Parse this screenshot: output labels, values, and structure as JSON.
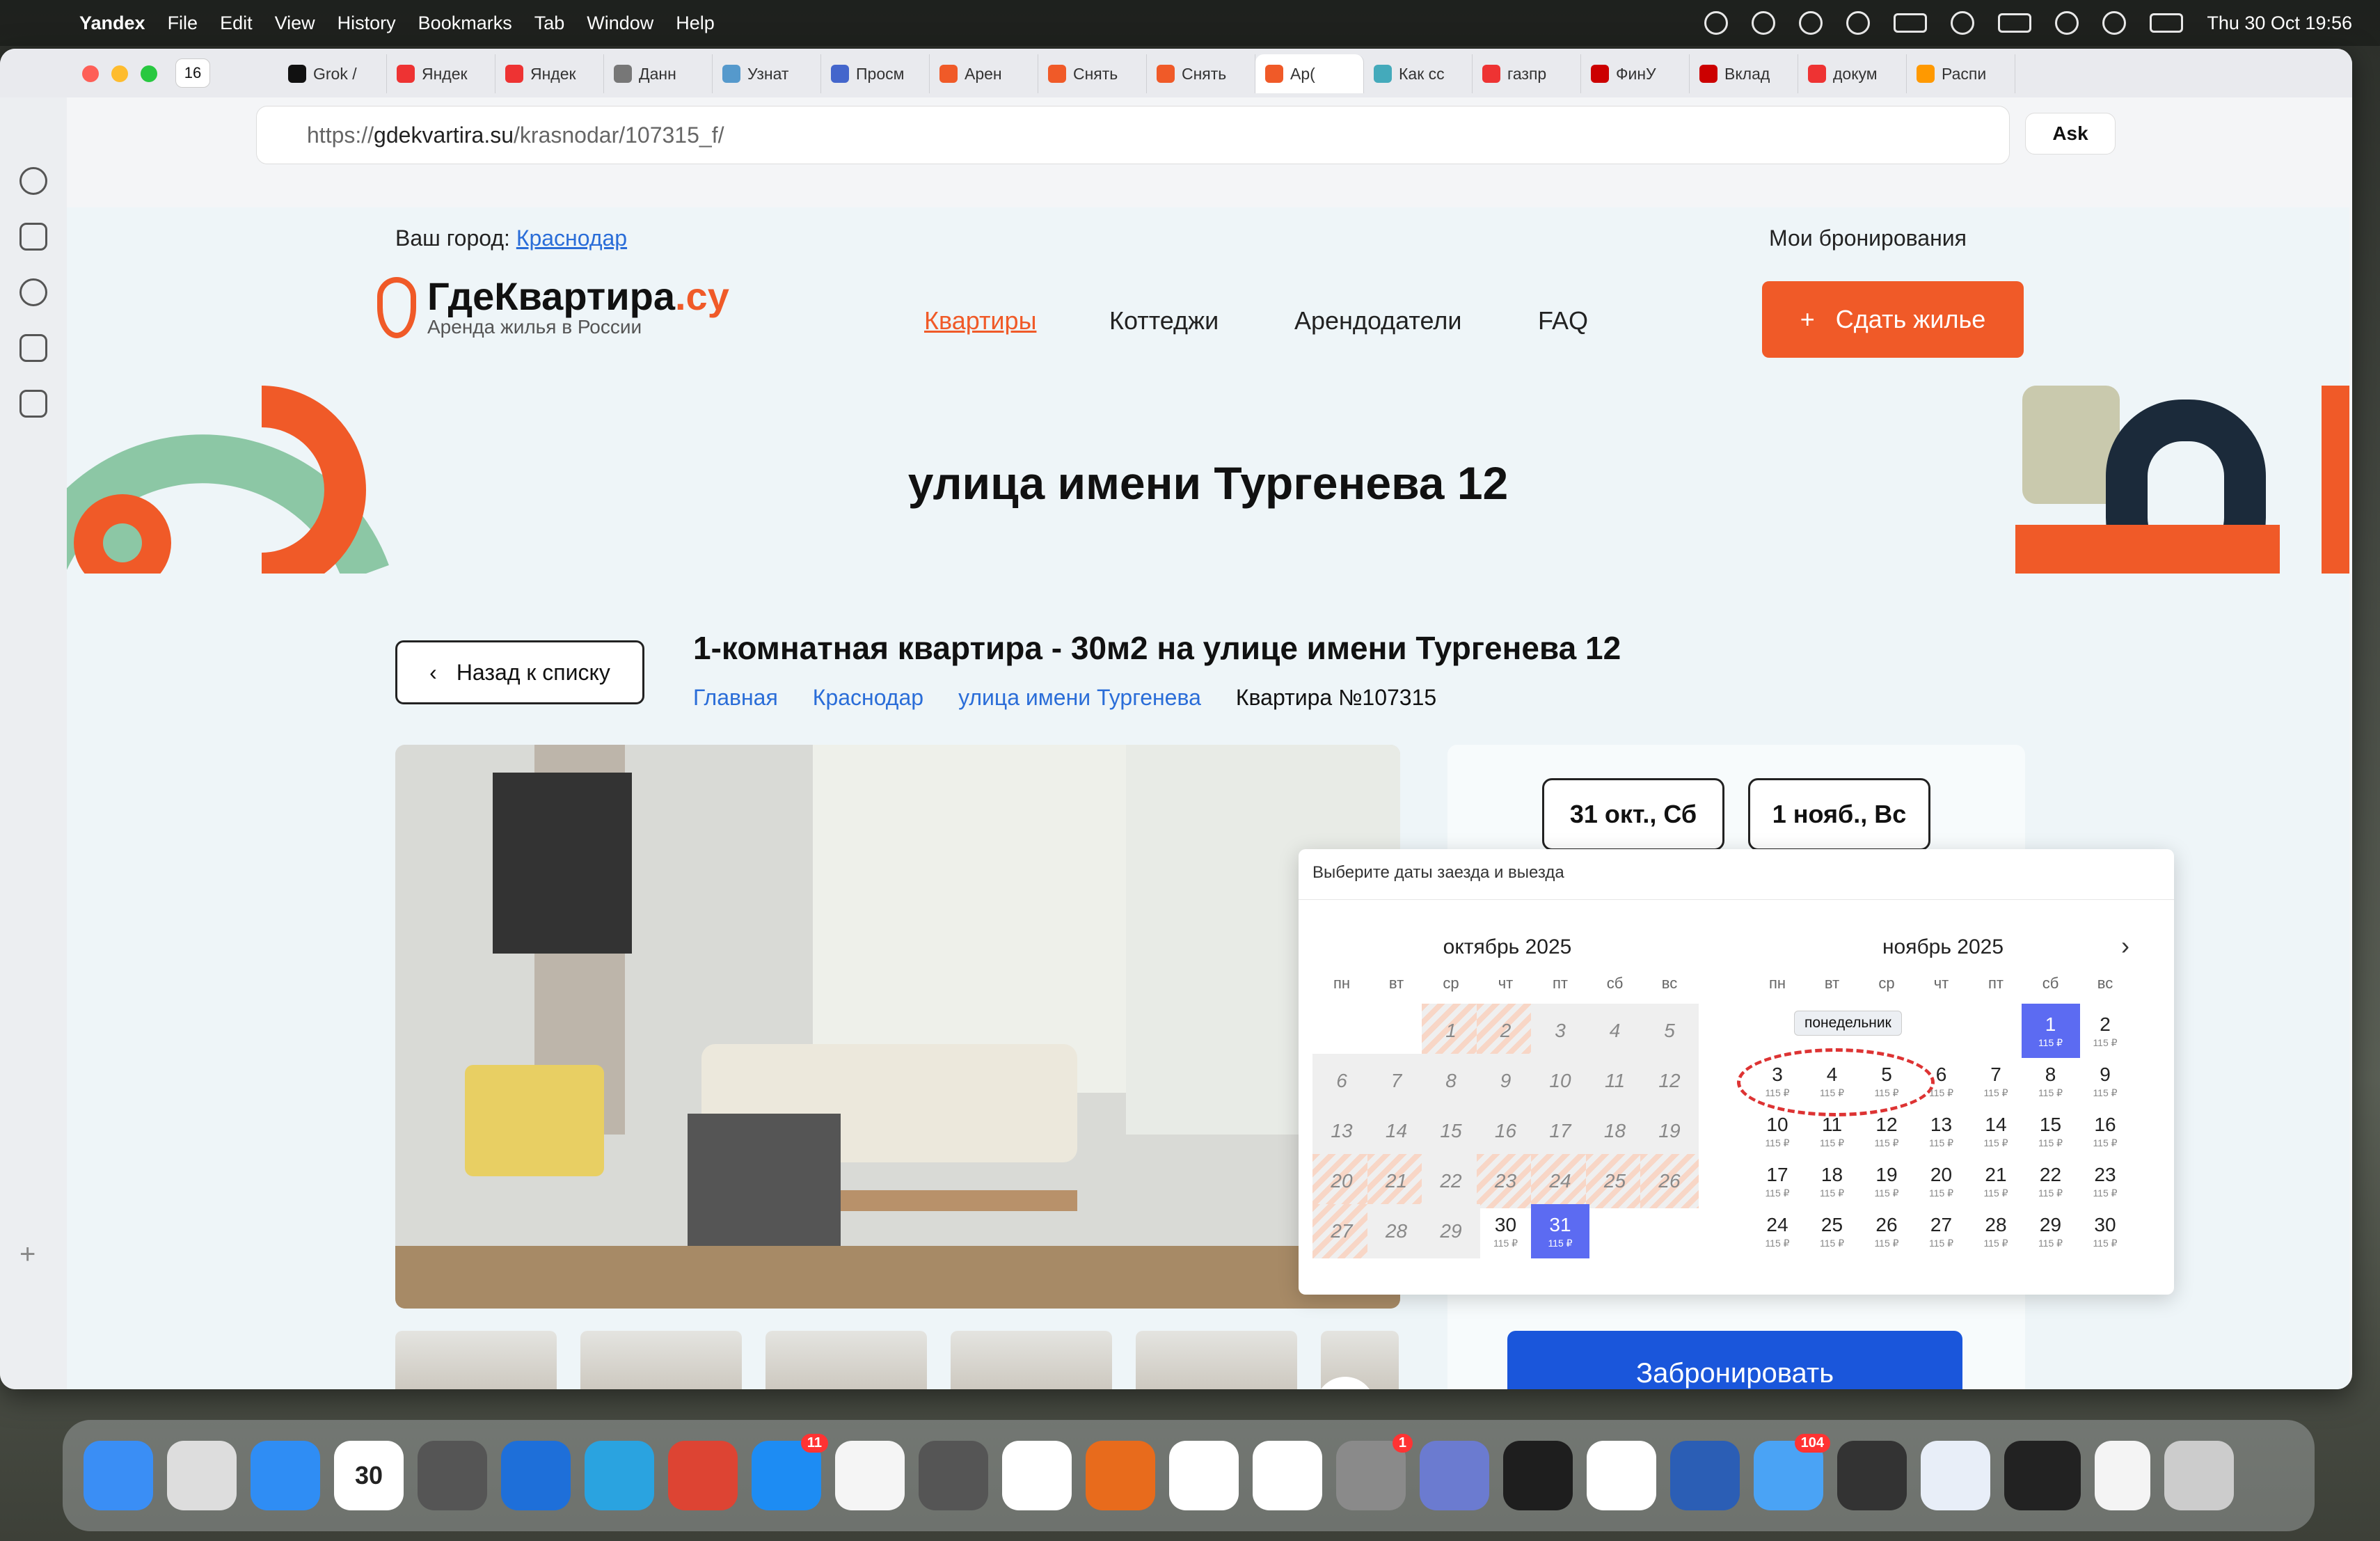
{
  "menubar": {
    "app": "Yandex",
    "items": [
      "File",
      "Edit",
      "View",
      "History",
      "Bookmarks",
      "Tab",
      "Window",
      "Help"
    ],
    "clock": "Thu 30 Oct  19:56"
  },
  "browser": {
    "tab_count": "16",
    "tabs": [
      {
        "label": "Grok /",
        "color": "#111"
      },
      {
        "label": "Яндек",
        "color": "#e33"
      },
      {
        "label": "Яндек",
        "color": "#e33"
      },
      {
        "label": "Данн",
        "color": "#777"
      },
      {
        "label": "Узнат",
        "color": "#59c"
      },
      {
        "label": "Просм",
        "color": "#46c"
      },
      {
        "label": "Арен",
        "color": "#f05a28"
      },
      {
        "label": "Снять",
        "color": "#f05a28"
      },
      {
        "label": "Снять",
        "color": "#f05a28"
      },
      {
        "label": "Ар(",
        "color": "#f05a28"
      },
      {
        "label": "Как сс",
        "color": "#4ab"
      },
      {
        "label": "газпр",
        "color": "#e33"
      },
      {
        "label": "ФинУ",
        "color": "#c00"
      },
      {
        "label": "Вклад",
        "color": "#c00"
      },
      {
        "label": "докум",
        "color": "#e33"
      },
      {
        "label": "Распи",
        "color": "#f90"
      }
    ],
    "url_prefix": "https://",
    "url_host": "gdekvartira.su",
    "url_path": "/krasnodar/107315_f/",
    "ask_label": "Ask"
  },
  "site": {
    "city_label": "Ваш город:",
    "city": "Краснодар",
    "my_bookings": "Мои бронирования",
    "logo_main": "ГдеКвартира",
    "logo_suffix": ".су",
    "logo_tagline": "Аренда жилья в России",
    "nav": [
      "Квартиры",
      "Коттеджи",
      "Арендодатели",
      "FAQ"
    ],
    "cta": "Сдать жилье",
    "cta_plus": "+",
    "hero_title": "улица имени Тургенева 12",
    "back_label": "Назад к списку",
    "listing_title": "1-комнатная квартира - 30м2 на улице имени Тургенева 12",
    "breadcrumbs": [
      "Главная",
      "Краснодар",
      "улица имени Тургенева"
    ],
    "apt_number": "Квартира №107315",
    "checkin": "31 окт., Сб",
    "checkout": "1 нояб., Вс",
    "book_button": "Забронировать"
  },
  "calendar": {
    "hint": "Выберите даты заезда и выезда",
    "tooltip": "понедельник",
    "weekdays": [
      "пн",
      "вт",
      "ср",
      "чт",
      "пт",
      "сб",
      "вс"
    ],
    "price": "115 ₽",
    "months": [
      {
        "title": "октябрь 2025"
      },
      {
        "title": "ноябрь 2025"
      }
    ]
  }
}
